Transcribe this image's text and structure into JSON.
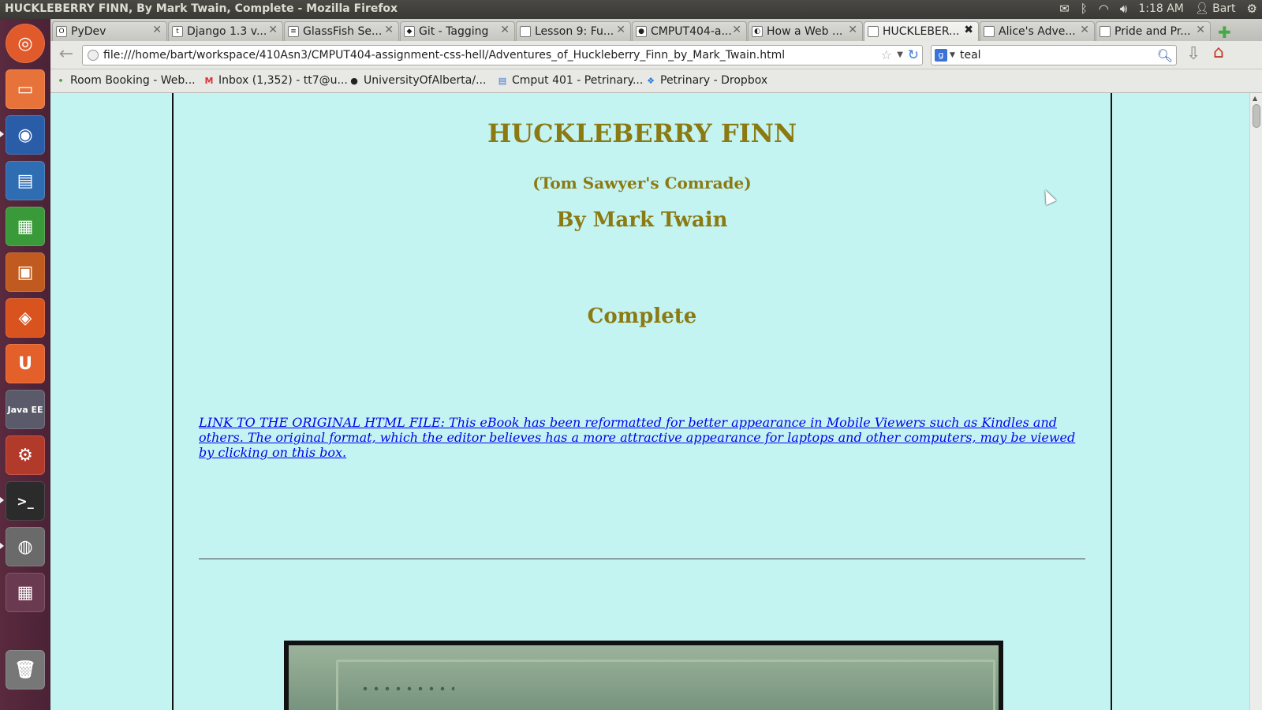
{
  "system": {
    "window_title": "HUCKLEBERRY FINN, By Mark Twain, Complete - Mozilla Firefox",
    "clock": "1:18 AM",
    "user": "Bart"
  },
  "tabs": [
    {
      "label": "PyDev",
      "favicon": "O"
    },
    {
      "label": "Django 1.3 v...",
      "favicon": "t"
    },
    {
      "label": "GlassFish Se...",
      "favicon": "≡"
    },
    {
      "label": "Git - Tagging",
      "favicon": "◆"
    },
    {
      "label": "Lesson 9: Fu...",
      "favicon": ""
    },
    {
      "label": "CMPUT404-a...",
      "favicon": "●"
    },
    {
      "label": "How a Web ...",
      "favicon": "◐"
    },
    {
      "label": "HUCKLEBER...",
      "favicon": ""
    },
    {
      "label": "Alice's Adve...",
      "favicon": ""
    },
    {
      "label": "Pride and Pr...",
      "favicon": ""
    }
  ],
  "navbar": {
    "url": "file:///home/bart/workspace/410Asn3/CMPUT404-assignment-css-hell/Adventures_of_Huckleberry_Finn_by_Mark_Twain.html",
    "search_value": "teal",
    "search_engine_icon": "g"
  },
  "bookmarks": [
    {
      "label": "Room Booking - Web...",
      "icon": "•"
    },
    {
      "label": "Inbox (1,352) - tt7@u...",
      "icon": "M"
    },
    {
      "label": "UniversityOfAlberta/...",
      "icon": "●"
    },
    {
      "label": "Cmput 401 - Petrinary...",
      "icon": "▤"
    },
    {
      "label": "Petrinary - Dropbox",
      "icon": "❖"
    }
  ],
  "page": {
    "title": "HUCKLEBERRY FINN",
    "subtitle": "(Tom Sawyer's Comrade)",
    "author": "By Mark Twain",
    "complete": "Complete",
    "original_link": "LINK TO THE ORIGINAL HTML FILE: This eBook has been reformatted for better appearance in Mobile Viewers such as Kindles and others. The original format, which the editor believes has a more attractive appearance for laptops and other computers, may be viewed by clicking on this box."
  },
  "colors": {
    "page_background": "#c4f4f2",
    "heading_color": "#8b7a12",
    "link_color": "#0000ee"
  }
}
